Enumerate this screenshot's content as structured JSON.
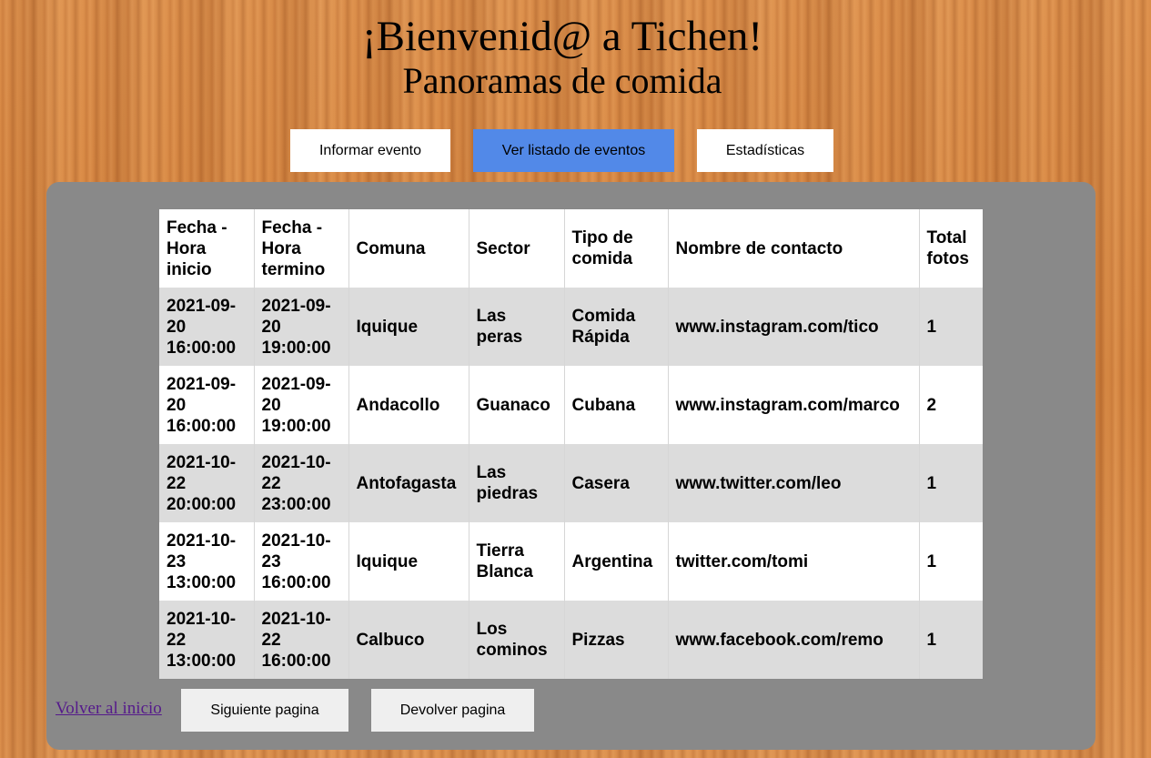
{
  "header": {
    "title": "¡Bienvenid@ a Tichen!",
    "subtitle": "Panoramas de comida"
  },
  "nav": {
    "informar_label": "Informar evento",
    "listado_label": "Ver listado de eventos",
    "estadisticas_label": "Estadísticas",
    "active": "listado",
    "active_color": "#5289e8"
  },
  "table": {
    "columns": [
      "Fecha - Hora inicio",
      "Fecha - Hora termino",
      "Comuna",
      "Sector",
      "Tipo de comida",
      "Nombre de contacto",
      "Total fotos"
    ],
    "rows": [
      [
        "2021-09-20 16:00:00",
        "2021-09-20 19:00:00",
        "Iquique",
        "Las peras",
        "Comida Rápida",
        "www.instagram.com/tico",
        "1"
      ],
      [
        "2021-09-20 16:00:00",
        "2021-09-20 19:00:00",
        "Andacollo",
        "Guanaco",
        "Cubana",
        "www.instagram.com/marco",
        "2"
      ],
      [
        "2021-10-22 20:00:00",
        "2021-10-22 23:00:00",
        "Antofagasta",
        "Las piedras",
        "Casera",
        "www.twitter.com/leo",
        "1"
      ],
      [
        "2021-10-23 13:00:00",
        "2021-10-23 16:00:00",
        "Iquique",
        "Tierra Blanca",
        "Argentina",
        "twitter.com/tomi",
        "1"
      ],
      [
        "2021-10-22 13:00:00",
        "2021-10-22 16:00:00",
        "Calbuco",
        "Los cominos",
        "Pizzas",
        "www.facebook.com/remo",
        "1"
      ]
    ]
  },
  "footer": {
    "home_link": "Volver al inicio",
    "next_label": "Siguiente pagina",
    "prev_label": "Devolver pagina"
  }
}
